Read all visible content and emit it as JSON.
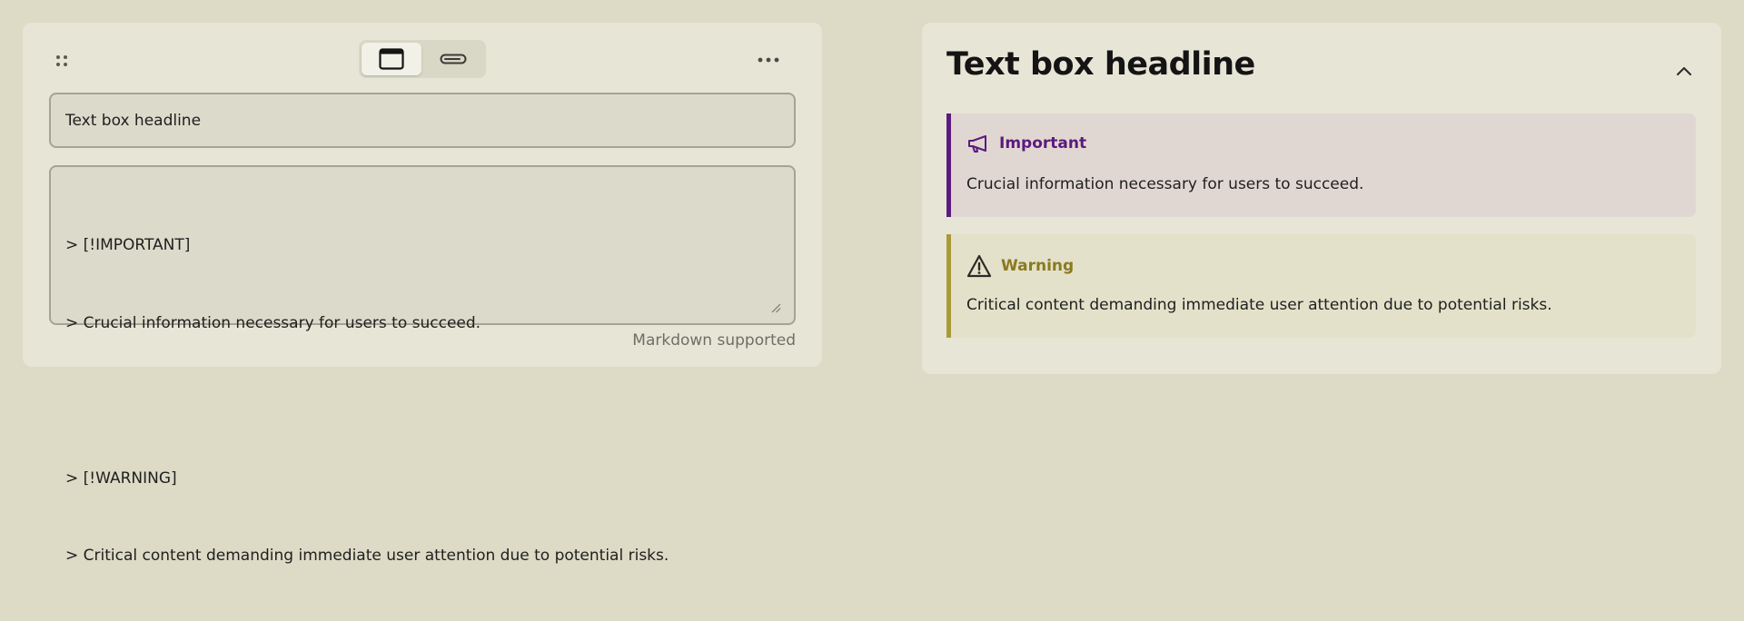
{
  "editor": {
    "mode_toggle": {
      "options": [
        {
          "name": "card-view",
          "icon": "window-icon",
          "selected": true
        },
        {
          "name": "inline-view",
          "icon": "inline-bar-icon",
          "selected": false
        }
      ]
    },
    "title_value": "Text box headline",
    "body_lines": [
      "> [!IMPORTANT]",
      "> Crucial information necessary for users to succeed.",
      "",
      "> [!WARNING]",
      "> Critical content demanding immediate user attention due to potential risks."
    ],
    "hint": "Markdown supported",
    "icons": {
      "drag": "drag-handle-icon",
      "more": "more-horizontal-icon",
      "resize": "resize-grip-icon"
    }
  },
  "preview": {
    "title": "Text box headline",
    "collapse_icon": "chevron-up-icon",
    "callouts": [
      {
        "type": "important",
        "icon": "megaphone-icon",
        "label": "Important",
        "text": "Crucial information necessary for users to succeed.",
        "accent": "#5b1a7d",
        "background": "#e1d7d2"
      },
      {
        "type": "warning",
        "icon": "warning-triangle-icon",
        "label": "Warning",
        "text": "Critical content demanding immediate user attention due to potential risks.",
        "accent": "#a99a38",
        "background": "#e3e1c9"
      }
    ]
  },
  "colors": {
    "page_background": "#dddbc5",
    "card_background": "#e7e5d6",
    "field_border": "#a5a396"
  }
}
